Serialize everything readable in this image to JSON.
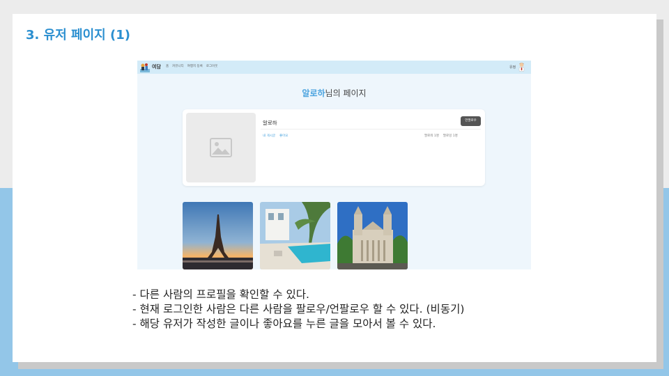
{
  "slide": {
    "title": "3. 유저 페이지 (1)"
  },
  "screenshot": {
    "nav": {
      "brand": "여담",
      "links": [
        "홈",
        "커뮤니티",
        "여행지 등록",
        "로그아웃"
      ],
      "user": "유정"
    },
    "page_heading": {
      "highlight": "알로하",
      "suffix": "님의 페이지"
    },
    "profile": {
      "name": "알로하",
      "follow_button": "언팔로우",
      "tabs": [
        "내 게시글",
        "좋아요"
      ],
      "stats": [
        "팔로워 1명",
        "팔로잉 1명"
      ]
    }
  },
  "bullets": [
    "- 다른 사람의 프로필을 확인할 수 있다.",
    "- 현재 로그인한 사람은 다른 사람을 팔로우/언팔로우 할 수 있다. (비동기)",
    "- 해당 유저가 작성한 글이나 좋아요를 누른 글을 모아서 볼 수 있다."
  ],
  "colors": {
    "accent": "#2b8fd0",
    "nav_bg": "#d3ebf8",
    "band_blue": "#93c6e8"
  },
  "icons": {
    "logo": "travel-family-logo-icon",
    "avatar": "user-avatar-icon",
    "placeholder": "image-placeholder-icon"
  }
}
